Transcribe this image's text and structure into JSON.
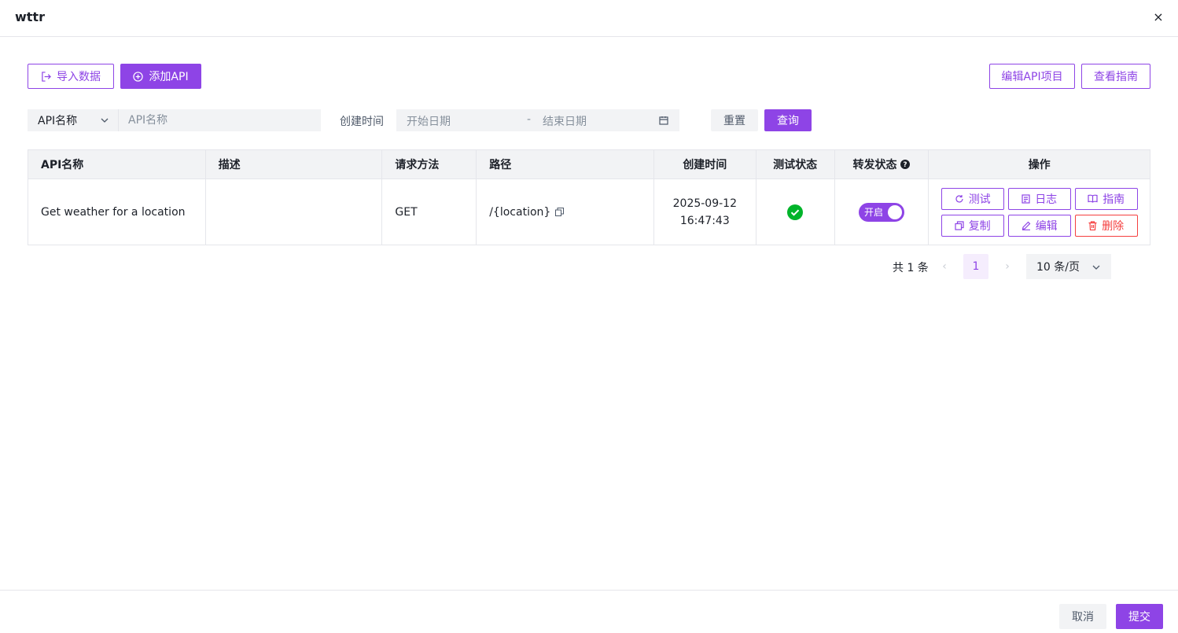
{
  "window": {
    "title": "wttr",
    "close_glyph": "×"
  },
  "toolbar": {
    "import_label": "导入数据",
    "add_api_label": "添加API",
    "edit_project_label": "编辑API项目",
    "guide_label": "查看指南"
  },
  "filter": {
    "field_select": "API名称",
    "name_placeholder": "API名称",
    "created_label": "创建时间",
    "start_placeholder": "开始日期",
    "range_sep": "-",
    "end_placeholder": "结束日期",
    "reset_label": "重置",
    "query_label": "查询"
  },
  "table": {
    "headers": [
      "API名称",
      "描述",
      "请求方法",
      "路径",
      "创建时间",
      "测试状态",
      "转发状态",
      "操作"
    ],
    "rows": [
      {
        "name": "Get weather for a location",
        "description": "",
        "method": "GET",
        "path": "/{location}",
        "created_date": "2025-09-12",
        "created_time": "16:47:43",
        "test_status": "passed",
        "forward_status": "开启",
        "forward_on": true
      }
    ],
    "actions": {
      "test": "测试",
      "log": "日志",
      "guide": "指南",
      "copy": "复制",
      "edit": "编辑",
      "delete": "删除"
    }
  },
  "pagination": {
    "total_text": "共 1 条",
    "prev_glyph": "‹",
    "current_page": "1",
    "next_glyph": "›",
    "page_size": "10 条/页"
  },
  "footer": {
    "cancel_label": "取消",
    "submit_label": "提交"
  },
  "colors": {
    "accent": "#8e44e6",
    "success": "#00b42a",
    "danger": "#f53f3f"
  }
}
